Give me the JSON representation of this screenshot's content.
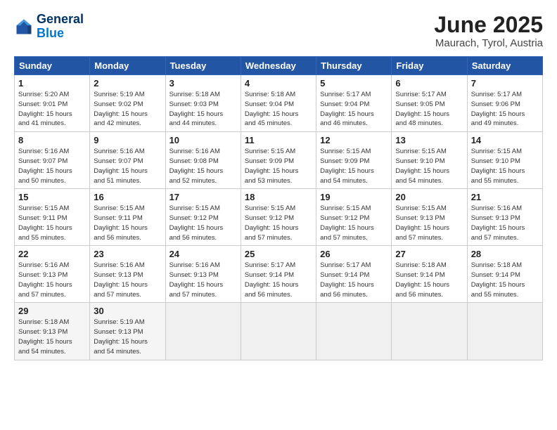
{
  "header": {
    "logo_line1": "General",
    "logo_line2": "Blue",
    "title": "June 2025",
    "subtitle": "Maurach, Tyrol, Austria"
  },
  "columns": [
    "Sunday",
    "Monday",
    "Tuesday",
    "Wednesday",
    "Thursday",
    "Friday",
    "Saturday"
  ],
  "weeks": [
    [
      {
        "day": "1",
        "info": "Sunrise: 5:20 AM\nSunset: 9:01 PM\nDaylight: 15 hours\nand 41 minutes."
      },
      {
        "day": "2",
        "info": "Sunrise: 5:19 AM\nSunset: 9:02 PM\nDaylight: 15 hours\nand 42 minutes."
      },
      {
        "day": "3",
        "info": "Sunrise: 5:18 AM\nSunset: 9:03 PM\nDaylight: 15 hours\nand 44 minutes."
      },
      {
        "day": "4",
        "info": "Sunrise: 5:18 AM\nSunset: 9:04 PM\nDaylight: 15 hours\nand 45 minutes."
      },
      {
        "day": "5",
        "info": "Sunrise: 5:17 AM\nSunset: 9:04 PM\nDaylight: 15 hours\nand 46 minutes."
      },
      {
        "day": "6",
        "info": "Sunrise: 5:17 AM\nSunset: 9:05 PM\nDaylight: 15 hours\nand 48 minutes."
      },
      {
        "day": "7",
        "info": "Sunrise: 5:17 AM\nSunset: 9:06 PM\nDaylight: 15 hours\nand 49 minutes."
      }
    ],
    [
      {
        "day": "8",
        "info": "Sunrise: 5:16 AM\nSunset: 9:07 PM\nDaylight: 15 hours\nand 50 minutes."
      },
      {
        "day": "9",
        "info": "Sunrise: 5:16 AM\nSunset: 9:07 PM\nDaylight: 15 hours\nand 51 minutes."
      },
      {
        "day": "10",
        "info": "Sunrise: 5:16 AM\nSunset: 9:08 PM\nDaylight: 15 hours\nand 52 minutes."
      },
      {
        "day": "11",
        "info": "Sunrise: 5:15 AM\nSunset: 9:09 PM\nDaylight: 15 hours\nand 53 minutes."
      },
      {
        "day": "12",
        "info": "Sunrise: 5:15 AM\nSunset: 9:09 PM\nDaylight: 15 hours\nand 54 minutes."
      },
      {
        "day": "13",
        "info": "Sunrise: 5:15 AM\nSunset: 9:10 PM\nDaylight: 15 hours\nand 54 minutes."
      },
      {
        "day": "14",
        "info": "Sunrise: 5:15 AM\nSunset: 9:10 PM\nDaylight: 15 hours\nand 55 minutes."
      }
    ],
    [
      {
        "day": "15",
        "info": "Sunrise: 5:15 AM\nSunset: 9:11 PM\nDaylight: 15 hours\nand 55 minutes."
      },
      {
        "day": "16",
        "info": "Sunrise: 5:15 AM\nSunset: 9:11 PM\nDaylight: 15 hours\nand 56 minutes."
      },
      {
        "day": "17",
        "info": "Sunrise: 5:15 AM\nSunset: 9:12 PM\nDaylight: 15 hours\nand 56 minutes."
      },
      {
        "day": "18",
        "info": "Sunrise: 5:15 AM\nSunset: 9:12 PM\nDaylight: 15 hours\nand 57 minutes."
      },
      {
        "day": "19",
        "info": "Sunrise: 5:15 AM\nSunset: 9:12 PM\nDaylight: 15 hours\nand 57 minutes."
      },
      {
        "day": "20",
        "info": "Sunrise: 5:15 AM\nSunset: 9:13 PM\nDaylight: 15 hours\nand 57 minutes."
      },
      {
        "day": "21",
        "info": "Sunrise: 5:16 AM\nSunset: 9:13 PM\nDaylight: 15 hours\nand 57 minutes."
      }
    ],
    [
      {
        "day": "22",
        "info": "Sunrise: 5:16 AM\nSunset: 9:13 PM\nDaylight: 15 hours\nand 57 minutes."
      },
      {
        "day": "23",
        "info": "Sunrise: 5:16 AM\nSunset: 9:13 PM\nDaylight: 15 hours\nand 57 minutes."
      },
      {
        "day": "24",
        "info": "Sunrise: 5:16 AM\nSunset: 9:13 PM\nDaylight: 15 hours\nand 57 minutes."
      },
      {
        "day": "25",
        "info": "Sunrise: 5:17 AM\nSunset: 9:14 PM\nDaylight: 15 hours\nand 56 minutes."
      },
      {
        "day": "26",
        "info": "Sunrise: 5:17 AM\nSunset: 9:14 PM\nDaylight: 15 hours\nand 56 minutes."
      },
      {
        "day": "27",
        "info": "Sunrise: 5:18 AM\nSunset: 9:14 PM\nDaylight: 15 hours\nand 56 minutes."
      },
      {
        "day": "28",
        "info": "Sunrise: 5:18 AM\nSunset: 9:14 PM\nDaylight: 15 hours\nand 55 minutes."
      }
    ],
    [
      {
        "day": "29",
        "info": "Sunrise: 5:18 AM\nSunset: 9:13 PM\nDaylight: 15 hours\nand 54 minutes."
      },
      {
        "day": "30",
        "info": "Sunrise: 5:19 AM\nSunset: 9:13 PM\nDaylight: 15 hours\nand 54 minutes."
      },
      {
        "day": "",
        "info": ""
      },
      {
        "day": "",
        "info": ""
      },
      {
        "day": "",
        "info": ""
      },
      {
        "day": "",
        "info": ""
      },
      {
        "day": "",
        "info": ""
      }
    ]
  ]
}
